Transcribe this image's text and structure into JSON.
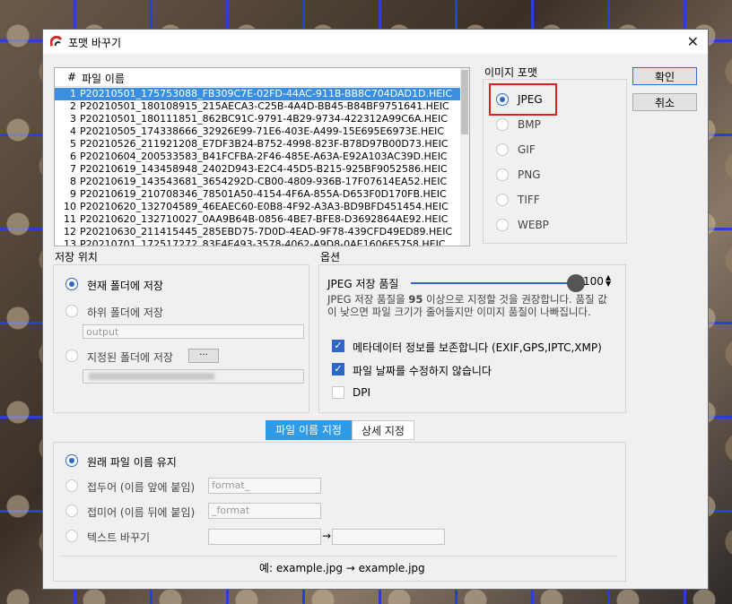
{
  "dialog": {
    "title": "포맷 바꾸기",
    "close": "✕"
  },
  "filelist": {
    "col_num": "#",
    "col_name": "파일 이름",
    "rows": [
      {
        "n": "1",
        "name": "P20210501_175753088_FB309C7E-02FD-44AC-911B-BB8C704DAD1D.HEIC"
      },
      {
        "n": "2",
        "name": "P20210501_180108915_215AECA3-C25B-4A4D-BB45-B84BF9751641.HEIC"
      },
      {
        "n": "3",
        "name": "P20210501_180111851_862BC91C-9791-4B29-9734-422312A99C6A.HEIC"
      },
      {
        "n": "4",
        "name": "P20210505_174338666_32926E99-71E6-403E-A499-15E695E6973E.HEIC"
      },
      {
        "n": "5",
        "name": "P20210526_211921208_E7DF3B24-B752-4998-823F-B78D97B00D73.HEIC"
      },
      {
        "n": "6",
        "name": "P20210604_200533583_B41FCFBA-2F46-485E-A63A-E92A103AC39D.HEIC"
      },
      {
        "n": "7",
        "name": "P20210619_143458948_2402D943-E2C4-45D5-B215-925BF9052586.HEIC"
      },
      {
        "n": "8",
        "name": "P20210619_143543681_3654292D-CB00-4809-936B-17F07614EA52.HEIC"
      },
      {
        "n": "9",
        "name": "P20210619_210708346_78501A50-4154-4F6A-855A-D653F0D170FB.HEIC"
      },
      {
        "n": "10",
        "name": "P20210620_132704589_46EAEC60-E0B8-4F92-A3A3-BD9BFD451454.HEIC"
      },
      {
        "n": "11",
        "name": "P20210620_132710027_0AA9B64B-0856-4BE7-BFE8-D3692864AE92.HEIC"
      },
      {
        "n": "12",
        "name": "P20210630_211415445_285EBD75-7D0D-4EAD-9F78-439CFD49ED89.HEIC"
      },
      {
        "n": "13",
        "name": "P20210701_172517272_83E4E493-3578-4062-A9D8-0AE1606F5758.HEIC"
      }
    ]
  },
  "format": {
    "label": "이미지 포맷",
    "options": [
      "JPEG",
      "BMP",
      "GIF",
      "PNG",
      "TIFF",
      "WEBP"
    ],
    "selected": "JPEG"
  },
  "buttons": {
    "ok": "확인",
    "cancel": "취소"
  },
  "save_location": {
    "label": "저장 위치",
    "current": "현재 폴더에 저장",
    "sub": "하위 폴더에 저장",
    "sub_placeholder": "output",
    "specified": "지정된 폴더에 저장",
    "browse": "···"
  },
  "options": {
    "label": "옵션",
    "quality_label": "JPEG 저장 품질",
    "quality_value": "100",
    "quality_fraction": 1.0,
    "quality_note_1": "JPEG 저장 품질을 ",
    "quality_note_bold": "95",
    "quality_note_2": " 이상으로 지정할 것을 권장합니다. 품질 값이 낮으면 파일 크기가 줄어들지만 이미지 품질이 나빠집니다.",
    "keep_metadata": "메타데이터 정보를 보존합니다 (EXIF,GPS,IPTC,XMP)",
    "keep_date": "파일 날짜를 수정하지 않습니다",
    "dpi": "DPI"
  },
  "tabs": {
    "filename": "파일 이름 지정",
    "detail": "상세 지정"
  },
  "naming": {
    "keep": "원래 파일 이름 유지",
    "prefix": "접두어 (이름 앞에 붙임)",
    "prefix_placeholder": "format_",
    "suffix": "접미어 (이름 뒤에 붙임)",
    "suffix_placeholder": "_format",
    "replace": "텍스트 바꾸기",
    "arrow": "→",
    "example": "예: example.jpg → example.jpg"
  },
  "colors": {
    "accent": "#2f67c9",
    "selection": "#3b8fe0",
    "highlight_box": "#e02020"
  }
}
